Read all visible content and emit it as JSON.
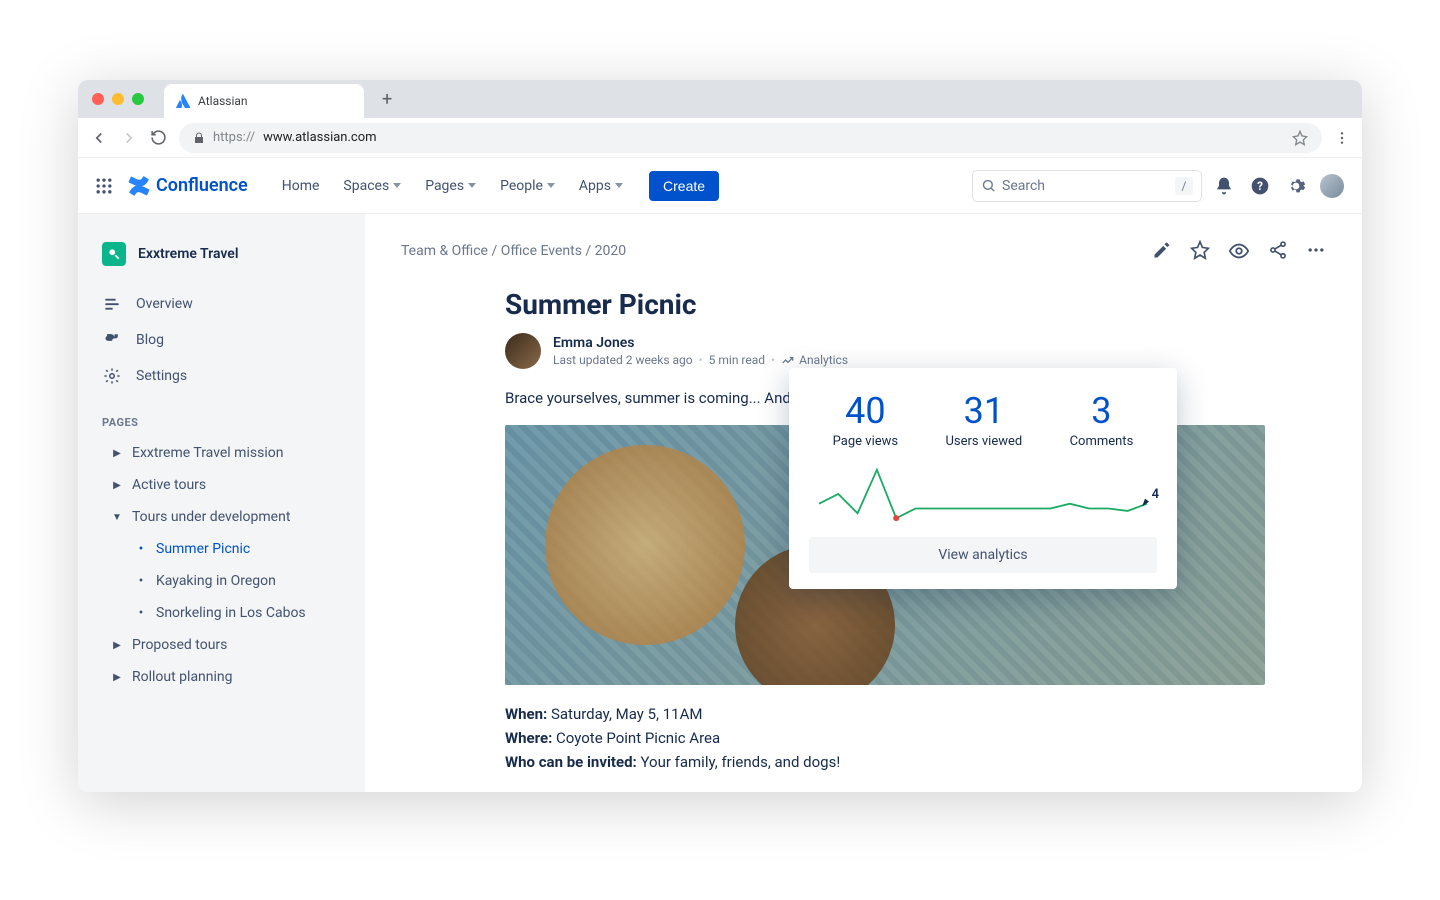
{
  "browser": {
    "tab_title": "Atlassian",
    "url_proto": "https://",
    "url_host": "www.atlassian.com"
  },
  "header": {
    "brand": "Confluence",
    "nav": {
      "home": "Home",
      "spaces": "Spaces",
      "pages": "Pages",
      "people": "People",
      "apps": "Apps"
    },
    "create": "Create",
    "search_placeholder": "Search",
    "search_shortcut": "/"
  },
  "sidebar": {
    "space_name": "Exxtreme Travel",
    "overview": "Overview",
    "blog": "Blog",
    "settings": "Settings",
    "pages_label": "PAGES",
    "tree": {
      "mission": "Exxtreme Travel mission",
      "active": "Active tours",
      "dev": "Tours under development",
      "dev_children": {
        "picnic": "Summer Picnic",
        "kayak": "Kayaking in Oregon",
        "snorkel": "Snorkeling in Los Cabos"
      },
      "proposed": "Proposed tours",
      "rollout": "Rollout planning"
    }
  },
  "page": {
    "breadcrumb": "Team & Office / Office Events / 2020",
    "title": "Summer Picnic",
    "author": "Emma Jones",
    "updated": "Last updated 2 weeks ago",
    "read_time": "5 min read",
    "analytics_label": "Analytics",
    "intro": "Brace yourselves, summer is coming... And w",
    "when_label": "When:",
    "when_value": " Saturday, May 5, 11AM",
    "where_label": "Where:",
    "where_value": " Coyote Point Picnic Area",
    "who_label": "Who can be invited:",
    "who_value": " Your family, friends, and dogs!"
  },
  "analytics": {
    "page_views": "40",
    "page_views_label": "Page views",
    "users_viewed": "31",
    "users_viewed_label": "Users viewed",
    "comments": "3",
    "comments_label": "Comments",
    "current_value": "4",
    "view_analytics": "View analytics"
  },
  "chart_data": {
    "type": "line",
    "title": "",
    "xlabel": "",
    "ylabel": "",
    "ylim": [
      0,
      12
    ],
    "values": [
      4,
      6,
      2,
      11,
      1,
      3,
      3,
      3,
      3,
      3,
      3,
      3,
      3,
      4,
      3,
      3,
      2.5,
      4
    ],
    "current": 4
  }
}
